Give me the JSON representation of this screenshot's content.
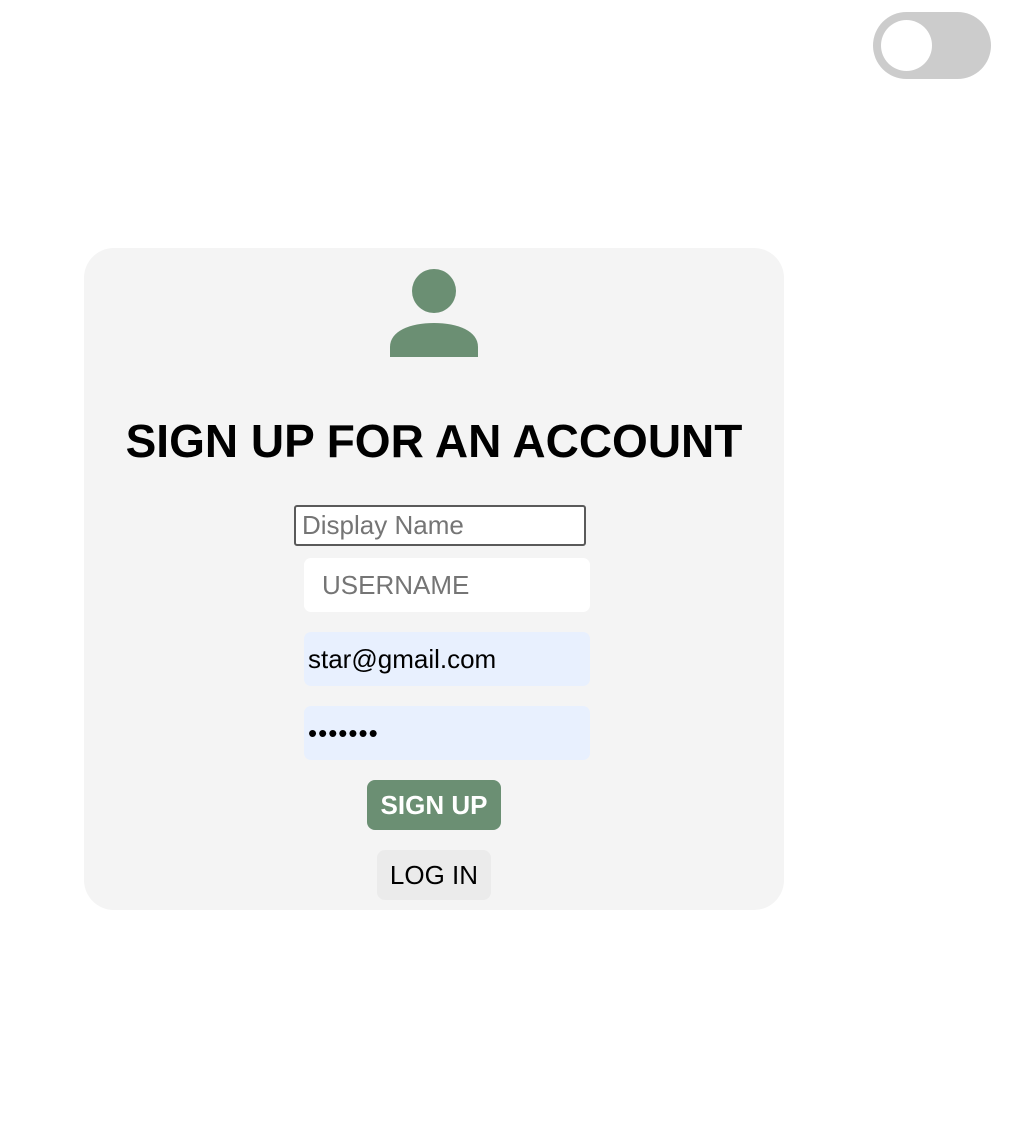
{
  "theme_toggle": {
    "state": "off"
  },
  "colors": {
    "accent": "#6b8f73",
    "card_background": "#f4f4f4",
    "autofill_background": "#e8f0fe",
    "toggle_track": "#cccccc"
  },
  "signup_form": {
    "icon": "user-icon",
    "title": "SIGN UP FOR AN ACCOUNT",
    "display_name": {
      "placeholder": "Display Name",
      "value": ""
    },
    "username": {
      "placeholder": "USERNAME",
      "value": ""
    },
    "email": {
      "value": "star@gmail.com"
    },
    "password": {
      "value": "•••••••"
    },
    "signup_label": "SIGN UP",
    "login_label": "LOG IN"
  }
}
